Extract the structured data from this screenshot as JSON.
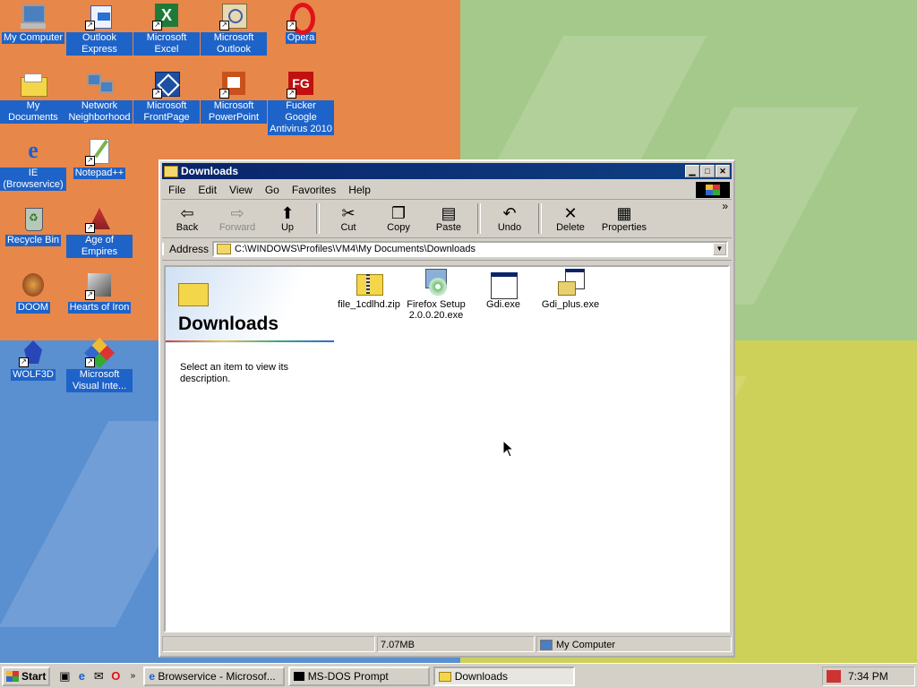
{
  "desktop": {
    "icons": [
      {
        "label": "My Computer"
      },
      {
        "label": "Outlook Express"
      },
      {
        "label": "Microsoft Excel"
      },
      {
        "label": "Microsoft Outlook"
      },
      {
        "label": "Opera"
      },
      {
        "label": "My Documents"
      },
      {
        "label": "Network Neighborhood"
      },
      {
        "label": "Microsoft FrontPage"
      },
      {
        "label": "Microsoft PowerPoint"
      },
      {
        "label": "Fucker Google Antivirus 2010"
      },
      {
        "label": "IE (Browservice)"
      },
      {
        "label": "Notepad++"
      },
      {
        "label": "Recycle Bin"
      },
      {
        "label": "Age of Empires"
      },
      {
        "label": "DOOM"
      },
      {
        "label": "Hearts of Iron"
      },
      {
        "label": "WOLF3D"
      },
      {
        "label": "Microsoft Visual Inte..."
      }
    ]
  },
  "window": {
    "title": "Downloads",
    "menu": [
      "File",
      "Edit",
      "View",
      "Go",
      "Favorites",
      "Help"
    ],
    "toolbar": [
      {
        "label": "Back",
        "icon": "arrow-left-icon"
      },
      {
        "label": "Forward",
        "icon": "arrow-right-icon"
      },
      {
        "label": "Up",
        "icon": "folder-up-icon"
      },
      {
        "label": "Cut",
        "icon": "scissors-icon"
      },
      {
        "label": "Copy",
        "icon": "copy-icon"
      },
      {
        "label": "Paste",
        "icon": "paste-icon"
      },
      {
        "label": "Undo",
        "icon": "undo-icon"
      },
      {
        "label": "Delete",
        "icon": "delete-icon"
      },
      {
        "label": "Properties",
        "icon": "properties-icon"
      }
    ],
    "address_label": "Address",
    "address_value": "C:\\WINDOWS\\Profiles\\VM4\\My Documents\\Downloads",
    "pane_title": "Downloads",
    "pane_desc": "Select an item to view its description.",
    "files": [
      {
        "name": "file_1cdlhd.zip",
        "icon": "zip-folder-icon"
      },
      {
        "name": "Firefox Setup 2.0.0.20.exe",
        "icon": "installer-cd-icon"
      },
      {
        "name": "Gdi.exe",
        "icon": "exe-window-icon"
      },
      {
        "name": "Gdi_plus.exe",
        "icon": "setup-exe-icon"
      }
    ],
    "status_size": "7.07MB",
    "status_zone": "My Computer"
  },
  "taskbar": {
    "start": "Start",
    "tasks": [
      {
        "label": "Browservice - Microsof..."
      },
      {
        "label": "MS-DOS Prompt"
      },
      {
        "label": "Downloads"
      }
    ],
    "time": "7:34 PM"
  },
  "colors": {
    "titlebar": "#0a246a",
    "chrome": "#d4d0c8",
    "desktop_label_bg": "#1e63c8"
  }
}
